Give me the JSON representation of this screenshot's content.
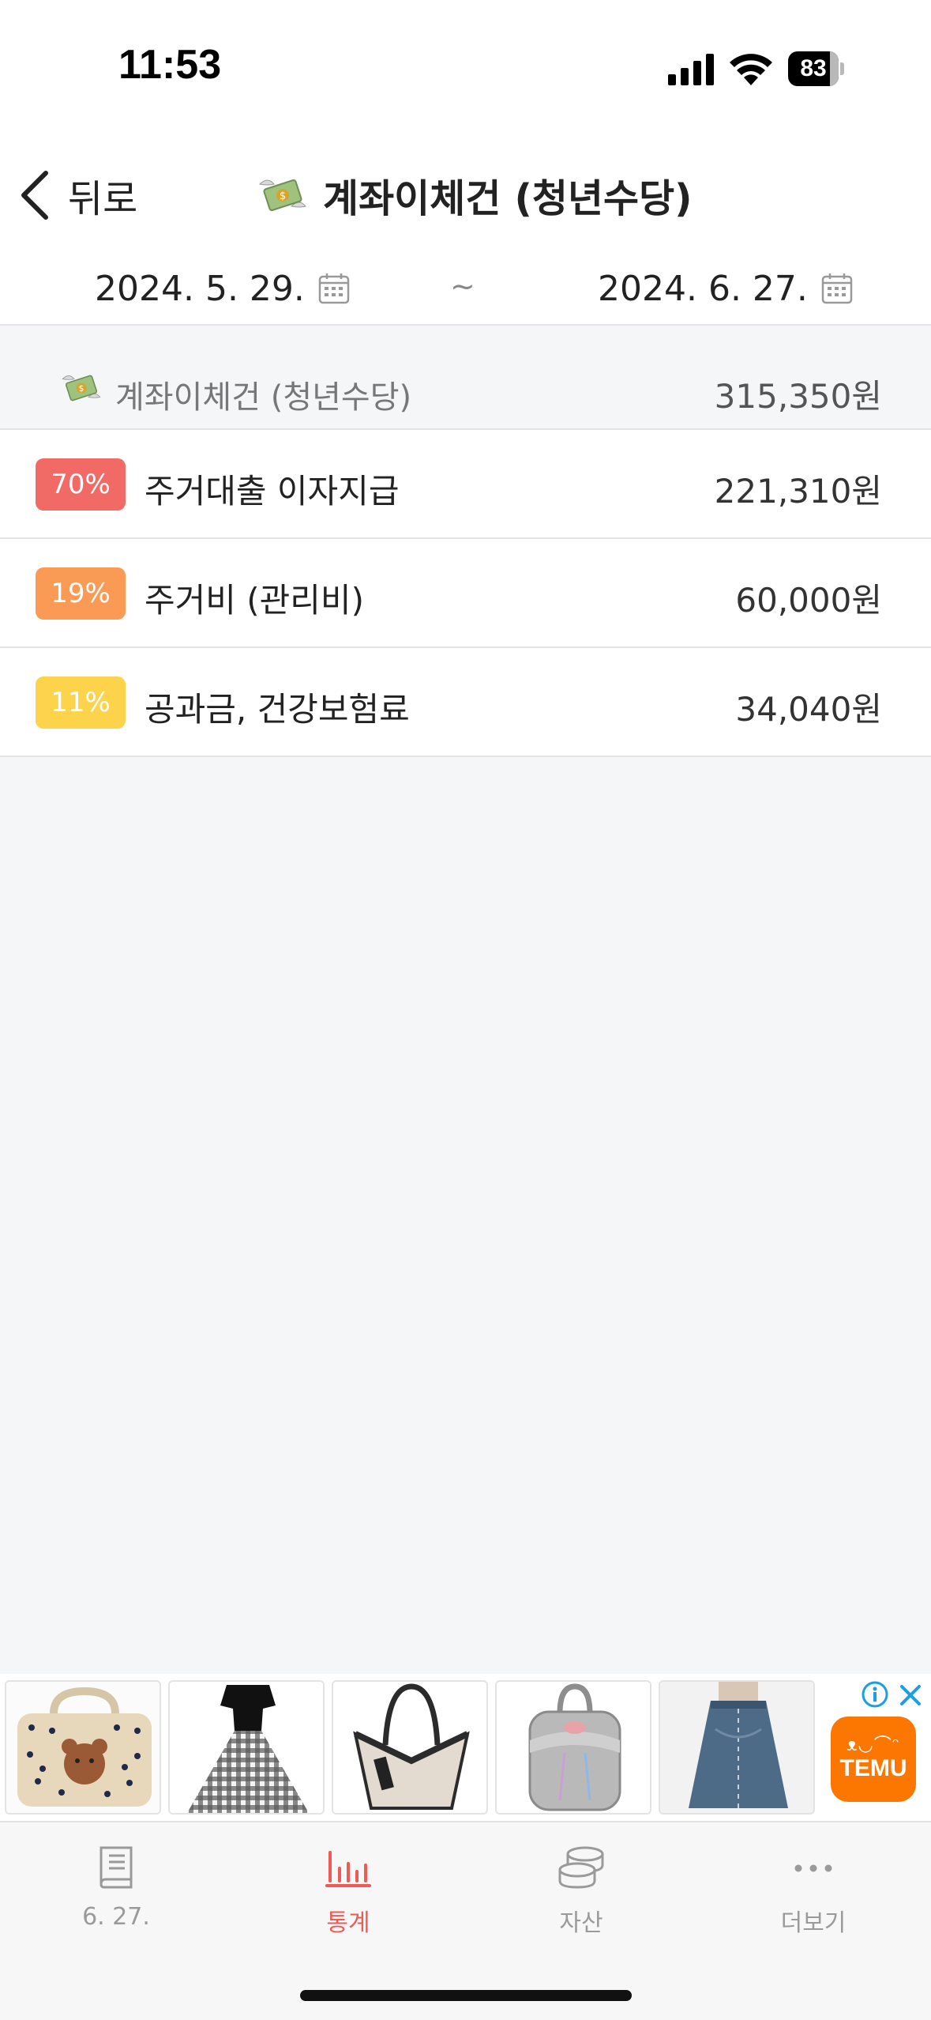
{
  "status_bar": {
    "time": "11:53",
    "battery": "83",
    "battery_level": 0.83
  },
  "header": {
    "back_label": "뒤로",
    "title": "계좌이체건 (청년수당)",
    "title_icon": "money-with-wings-icon",
    "date_start": "2024. 5. 29.",
    "date_end": "2024. 6. 27.",
    "range_separator": "~"
  },
  "summary": {
    "label": "계좌이체건 (청년수당)",
    "amount": "315,350원"
  },
  "items": [
    {
      "percent": "70%",
      "label": "주거대출 이자지급",
      "amount": "221,310원",
      "color": "#f26a66"
    },
    {
      "percent": "19%",
      "label": "주거비 (관리비)",
      "amount": "60,000원",
      "color": "#fb9a55"
    },
    {
      "percent": "11%",
      "label": "공과금, 건강보험료",
      "amount": "34,040원",
      "color": "#fdd34c"
    }
  ],
  "ad": {
    "brand": "TEMU",
    "products": [
      "laptop-bag",
      "gingham-dress",
      "tote-bag",
      "silver-backpack",
      "denim-skirt"
    ]
  },
  "tabs": [
    {
      "label": "6. 27.",
      "icon": "book-icon",
      "active": false
    },
    {
      "label": "통계",
      "icon": "bar-chart-icon",
      "active": true
    },
    {
      "label": "자산",
      "icon": "coins-icon",
      "active": false
    },
    {
      "label": "더보기",
      "icon": "more-dots-icon",
      "active": false
    }
  ],
  "colors": {
    "accent": "#ee5a54",
    "background": "#f5f6f8"
  }
}
